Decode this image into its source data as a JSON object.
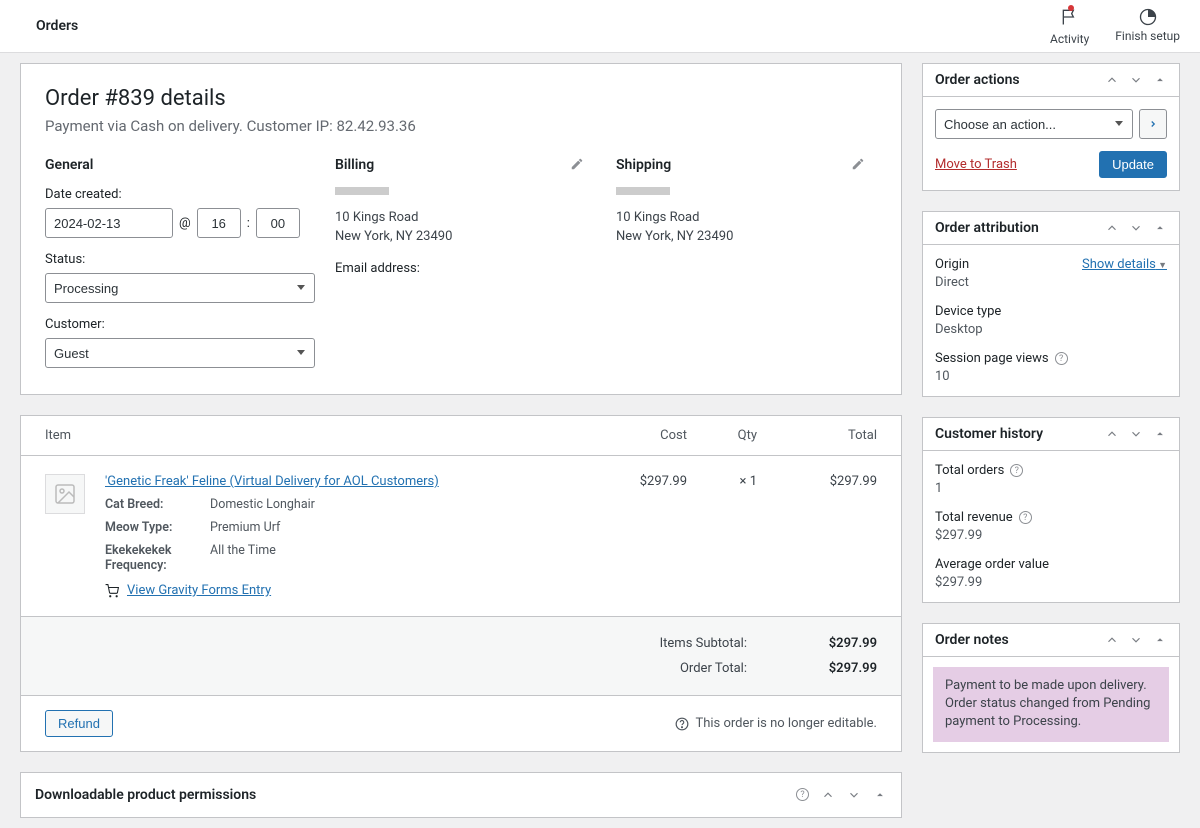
{
  "topbar": {
    "title": "Orders",
    "activity": "Activity",
    "finish_setup": "Finish setup"
  },
  "order": {
    "title": "Order #839 details",
    "subtitle": "Payment via Cash on delivery. Customer IP: 82.42.93.36",
    "general_heading": "General",
    "billing_heading": "Billing",
    "shipping_heading": "Shipping",
    "date_label": "Date created:",
    "date_value": "2024-02-13",
    "hour_value": "16",
    "minute_value": "00",
    "at_symbol": "@",
    "colon_symbol": ":",
    "status_label": "Status:",
    "status_value": "Processing",
    "customer_label": "Customer:",
    "customer_value": "Guest",
    "billing_line1": "10 Kings Road",
    "billing_line2": "New York, NY 23490",
    "email_label": "Email address:",
    "shipping_line1": "10 Kings Road",
    "shipping_line2": "New York, NY 23490"
  },
  "items": {
    "header_item": "Item",
    "header_cost": "Cost",
    "header_qty": "Qty",
    "header_total": "Total",
    "rows": [
      {
        "name": "'Genetic Freak' Feline (Virtual Delivery for AOL Customers)",
        "cost": "$297.99",
        "qty": "× 1",
        "total": "$297.99",
        "meta": {
          "k1": "Cat Breed:",
          "v1": "Domestic Longhair",
          "k2": "Meow Type:",
          "v2": "Premium Urf",
          "k3": "Ekekekekek Frequency:",
          "v3": "All the Time"
        },
        "gf_link": "View Gravity Forms Entry"
      }
    ],
    "subtotal_label": "Items Subtotal:",
    "subtotal_value": "$297.99",
    "total_label": "Order Total:",
    "total_value": "$297.99",
    "refund_button": "Refund",
    "not_editable": "This order is no longer editable."
  },
  "downloadable": {
    "title": "Downloadable product permissions"
  },
  "actions": {
    "title": "Order actions",
    "select_placeholder": "Choose an action...",
    "trash": "Move to Trash",
    "update": "Update"
  },
  "attribution": {
    "title": "Order attribution",
    "origin_k": "Origin",
    "origin_v": "Direct",
    "details_toggle": "Show details",
    "device_k": "Device type",
    "device_v": "Desktop",
    "views_k": "Session page views",
    "views_v": "10"
  },
  "history": {
    "title": "Customer history",
    "orders_k": "Total orders",
    "orders_v": "1",
    "revenue_k": "Total revenue",
    "revenue_v": "$297.99",
    "avg_k": "Average order value",
    "avg_v": "$297.99"
  },
  "notes": {
    "title": "Order notes",
    "note1": "Payment to be made upon delivery. Order status changed from Pending payment to Processing."
  }
}
